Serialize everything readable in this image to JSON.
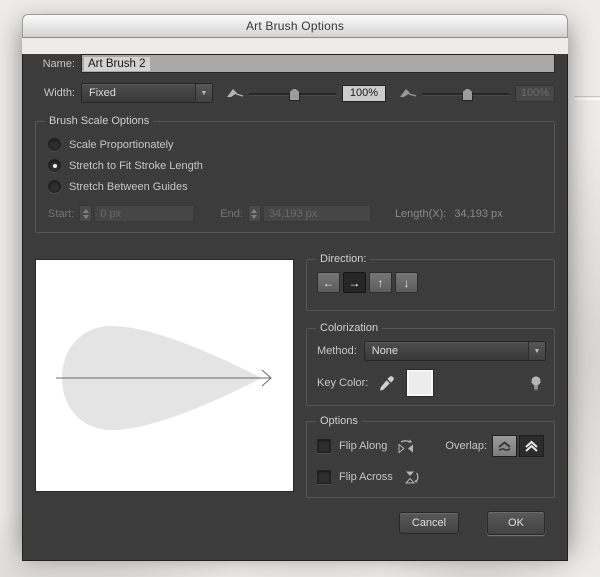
{
  "window": {
    "title": "Art Brush Options"
  },
  "colors": {
    "dialog_bg": "#3c3c3c",
    "titlebar_top": "#fbfbfb",
    "preview_bg": "#ffffff",
    "brush_fill": "#e4e4e4",
    "key_color_swatch": "#ececec",
    "selected_button_bg": "#262626"
  },
  "name_field": {
    "label": "Name:",
    "value": "Art Brush 2"
  },
  "width_row": {
    "label": "Width:",
    "dropdown_value": "Fixed",
    "slider1_value": "100%",
    "slider2_value": "100%",
    "slider2_disabled": true
  },
  "brush_scale": {
    "legend": "Brush Scale Options",
    "options": [
      {
        "label": "Scale Proportionately",
        "selected": false
      },
      {
        "label": "Stretch to Fit Stroke Length",
        "selected": true
      },
      {
        "label": "Stretch Between Guides",
        "selected": false
      }
    ],
    "start_label": "Start:",
    "start_value": "0 px",
    "end_label": "End:",
    "end_value": "34,193 px",
    "length_label": "Length(X):",
    "length_value": "34,193 px"
  },
  "direction": {
    "legend": "Direction:",
    "buttons": [
      {
        "name": "left",
        "glyph": "←",
        "selected": false
      },
      {
        "name": "right",
        "glyph": "→",
        "selected": true
      },
      {
        "name": "up",
        "glyph": "↑",
        "selected": false
      },
      {
        "name": "down",
        "glyph": "↓",
        "selected": false
      }
    ]
  },
  "colorization": {
    "legend": "Colorization",
    "method_label": "Method:",
    "method_value": "None",
    "key_color_label": "Key Color:"
  },
  "options": {
    "legend": "Options",
    "flip_along_label": "Flip Along",
    "flip_across_label": "Flip Across",
    "overlap_label": "Overlap:"
  },
  "buttons": {
    "cancel": "Cancel",
    "ok": "OK"
  },
  "icons": [
    "dropdown-arrow-icon",
    "pen-pressure-icon",
    "stepper-icon",
    "arrow-left-icon",
    "arrow-right-icon",
    "arrow-up-icon",
    "arrow-down-icon",
    "eyedropper-icon",
    "lightbulb-icon",
    "flip-along-icon",
    "flip-across-icon",
    "overlap-none-icon",
    "overlap-adjust-icon",
    "brush-preview-teardrop"
  ]
}
